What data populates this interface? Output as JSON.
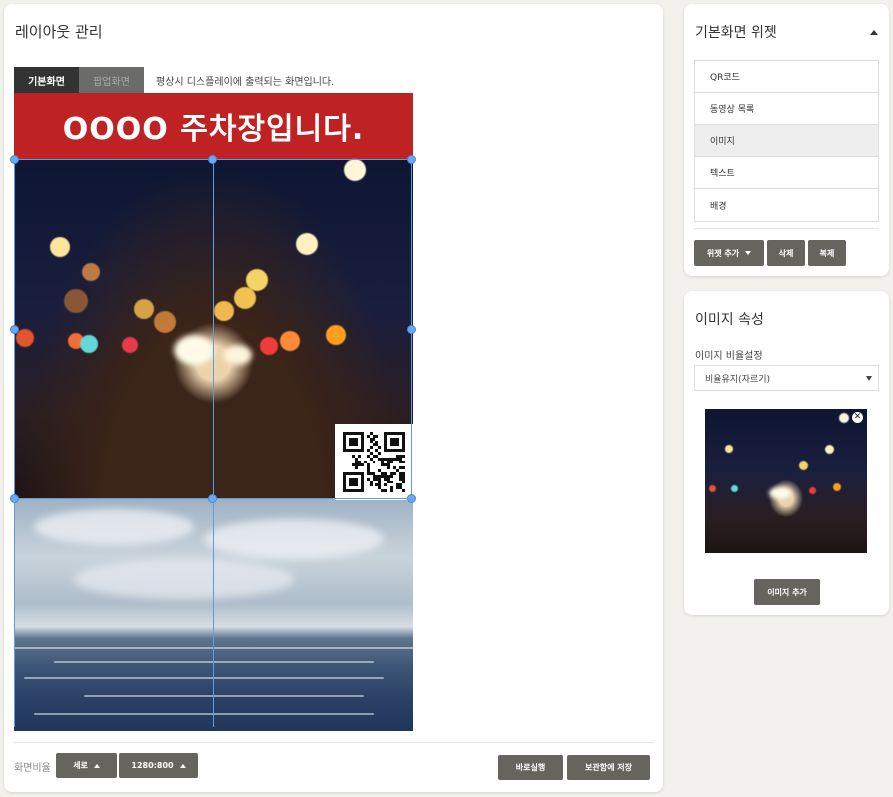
{
  "layout": {
    "title": "레이아웃 관리",
    "tabs": [
      {
        "label": "기본화면",
        "active": true
      },
      {
        "label": "팝업화면",
        "active": false
      }
    ],
    "tab_description": "평상시 디스플레이에 출력되는 화면입니다.",
    "banner_text": "OOOO 주차장입니다.",
    "screen_ratio_label": "화면비율",
    "orientation_button": "세로",
    "resolution_button": "1280:800",
    "run_button": "바로실행",
    "save_button": "보관함에 저장"
  },
  "widgets_panel": {
    "title": "기본화면 위젯",
    "items": [
      {
        "label": "QR코드",
        "selected": false
      },
      {
        "label": "동영상 목록",
        "selected": false
      },
      {
        "label": "이미지",
        "selected": true
      },
      {
        "label": "텍스트",
        "selected": false
      },
      {
        "label": "배경",
        "selected": false
      }
    ],
    "add_widget_button": "위젯 추가",
    "delete_button": "삭제",
    "duplicate_button": "복제"
  },
  "image_props": {
    "title": "이미지 속성",
    "ratio_label": "이미지 비율설정",
    "ratio_value": "비율유지(자르기)",
    "add_image_button": "이미지 추가"
  },
  "colors": {
    "banner": "#bf2222",
    "button": "#66645e",
    "guide": "#5b9be8"
  },
  "icons": {
    "remove": "close-circle-icon",
    "collapse": "caret-up-icon",
    "dropdown": "caret-down-icon"
  }
}
